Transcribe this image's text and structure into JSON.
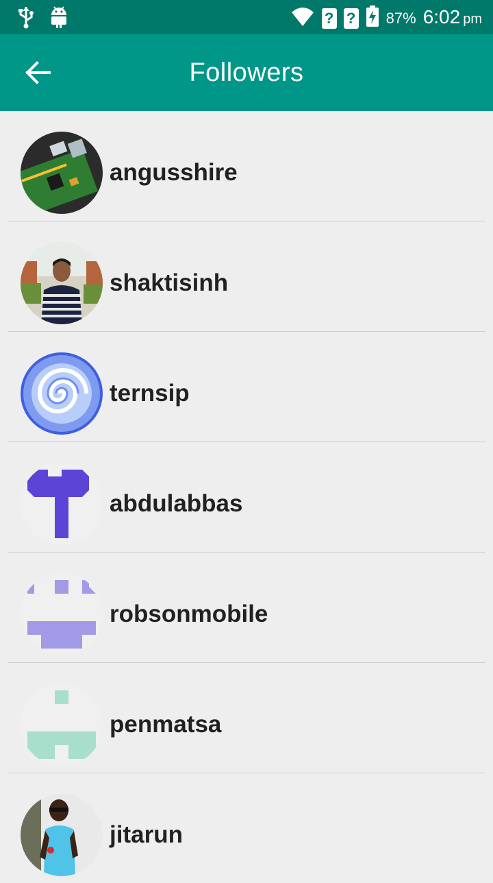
{
  "status_bar": {
    "battery_percent": "87%",
    "time": "6:02",
    "ampm": "pm"
  },
  "app_bar": {
    "title": "Followers"
  },
  "followers": [
    {
      "username": "angusshire"
    },
    {
      "username": "shaktisinh"
    },
    {
      "username": "ternsip"
    },
    {
      "username": "abdulabbas"
    },
    {
      "username": "robsonmobile"
    },
    {
      "username": "penmatsa"
    },
    {
      "username": "jitarun"
    }
  ],
  "colors": {
    "status_bar": "#00796b",
    "app_bar": "#009688",
    "background": "#eeeeee",
    "identicon_abdulabbas": "#5c45d6",
    "identicon_robsonmobile": "#a29ae6",
    "identicon_penmatsa": "#a8dfcc"
  }
}
